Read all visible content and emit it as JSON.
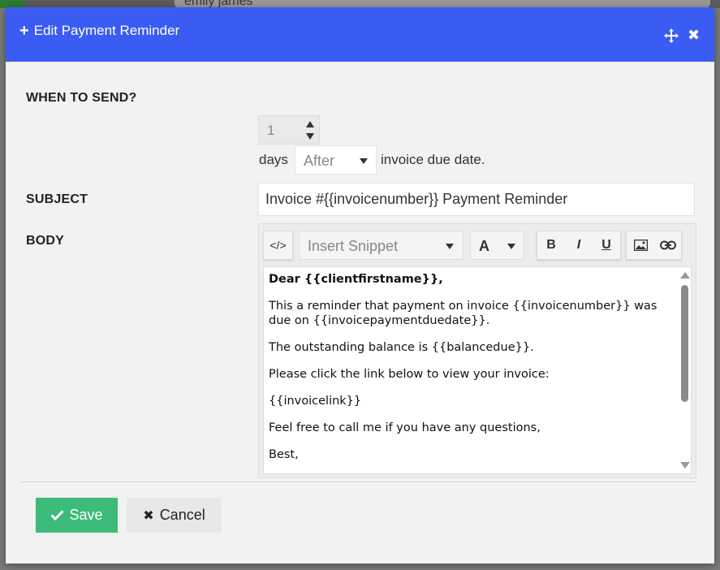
{
  "background": {
    "search_text": "emily james"
  },
  "modal": {
    "title": "Edit Payment Reminder",
    "when_label": "WHEN TO SEND?",
    "days_value": "1",
    "days_label": "days",
    "timing_value": "After",
    "due_label": "invoice due date.",
    "subject_label": "SUBJECT",
    "subject_value": "Invoice #{{invoicenumber}} Payment Reminder",
    "body_label": "BODY",
    "toolbar": {
      "code_icon": "</>",
      "snippet_placeholder": "Insert Snippet",
      "font_label": "A",
      "bold": "B",
      "italic": "I",
      "underline": "U"
    },
    "body_lines": [
      "Dear {{clientfirstname}},",
      "This a reminder that payment on invoice {{invoicenumber}} was due on {{invoicepaymentduedate}}.",
      "The outstanding balance is {{balancedue}}.",
      "Please click the link below to view your invoice:",
      "{{invoicelink}}",
      "Feel free to call me if you have any questions,",
      "Best,"
    ],
    "save_label": "Save",
    "cancel_label": "Cancel"
  },
  "colors": {
    "header": "#3b5cf2",
    "save": "#3dbb7a",
    "cancel": "#e8e8e8"
  }
}
